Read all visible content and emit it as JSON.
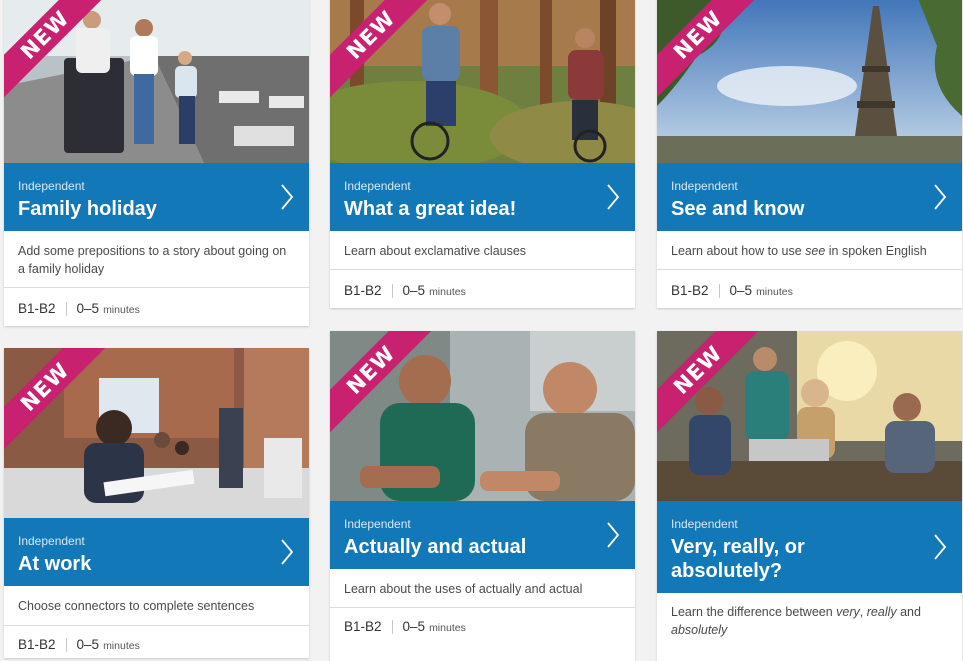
{
  "badge_text": "NEW",
  "colors": {
    "accent": "#1278b8",
    "badge": "#c8216f"
  },
  "cards": [
    {
      "level_label": "Independent",
      "title": "Family holiday",
      "description": "Add some prepositions to a story about going on a family holiday",
      "cefr": "B1-B2",
      "duration": "0–5",
      "unit": "minutes",
      "arrow_icon": "chevron-right-icon"
    },
    {
      "level_label": "Independent",
      "title": "What a great idea!",
      "description": "Learn about exclamative clauses",
      "cefr": "B1-B2",
      "duration": "0–5",
      "unit": "minutes",
      "arrow_icon": "chevron-right-icon"
    },
    {
      "level_label": "Independent",
      "title": "See and know",
      "description_parts": [
        "Learn about how to use ",
        "see",
        " in spoken English"
      ],
      "cefr": "B1-B2",
      "duration": "0–5",
      "unit": "minutes",
      "arrow_icon": "chevron-right-icon"
    },
    {
      "level_label": "Independent",
      "title": "At work",
      "description": "Choose connectors to complete sentences",
      "cefr": "B1-B2",
      "duration": "0–5",
      "unit": "minutes",
      "arrow_icon": "chevron-right-icon"
    },
    {
      "level_label": "Independent",
      "title": "Actually and actual",
      "description": "Learn about the uses of actually and actual",
      "cefr": "B1-B2",
      "duration": "0–5",
      "unit": "minutes",
      "arrow_icon": "chevron-right-icon"
    },
    {
      "level_label": "Independent",
      "title_line1": "Very, really, or",
      "title_line2": "absolutely?",
      "description_parts": [
        "Learn the difference between ",
        "very",
        ", ",
        "really",
        " and ",
        "absolutely"
      ],
      "arrow_icon": "chevron-right-icon"
    }
  ]
}
